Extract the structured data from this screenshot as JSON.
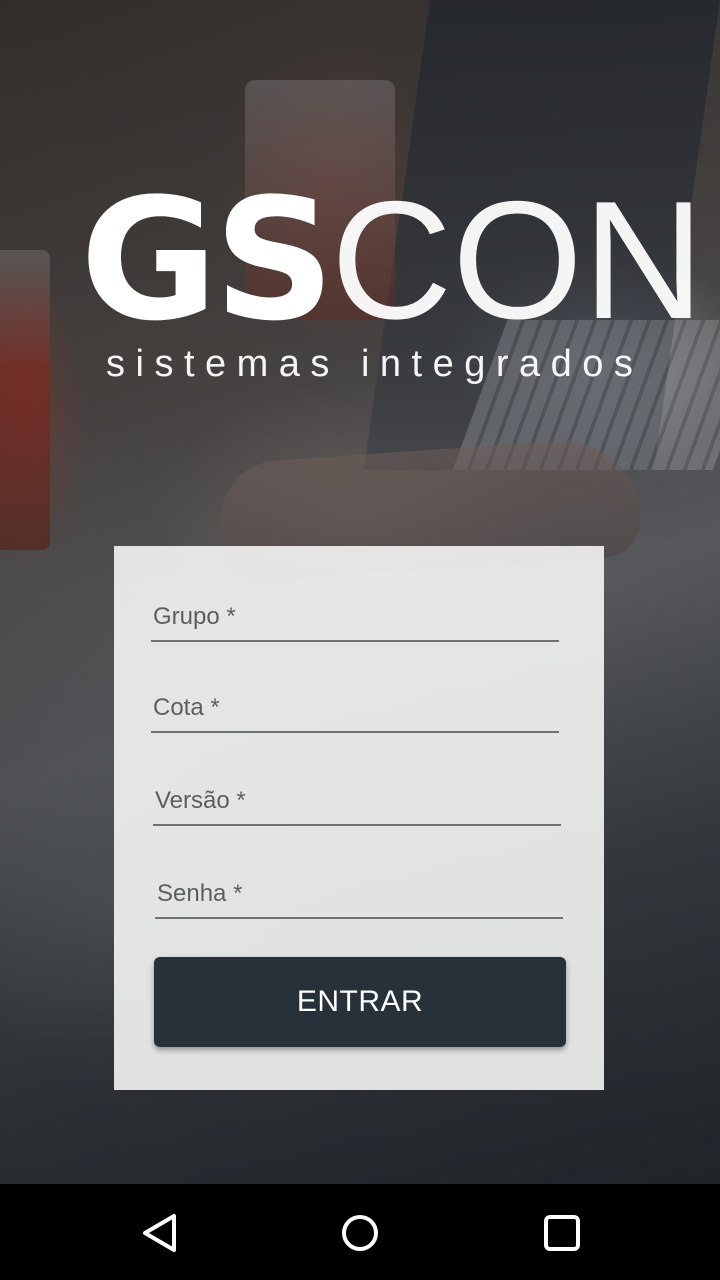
{
  "logo": {
    "main_bold": "GS",
    "main_light": "CON",
    "tagline": "sistemas integrados"
  },
  "form": {
    "group": {
      "placeholder": "Grupo *",
      "value": ""
    },
    "quota": {
      "placeholder": "Cota *",
      "value": ""
    },
    "version": {
      "placeholder": "Versão *",
      "value": ""
    },
    "password": {
      "placeholder": "Senha *",
      "value": ""
    },
    "submit_label": "ENTRAR"
  },
  "navbar": {
    "back_icon": "back-triangle-icon",
    "home_icon": "home-circle-icon",
    "recents_icon": "recents-square-icon"
  },
  "colors": {
    "button_bg": "#27313a",
    "card_bg": "#f5f5f5",
    "navbar_bg": "#000000"
  }
}
